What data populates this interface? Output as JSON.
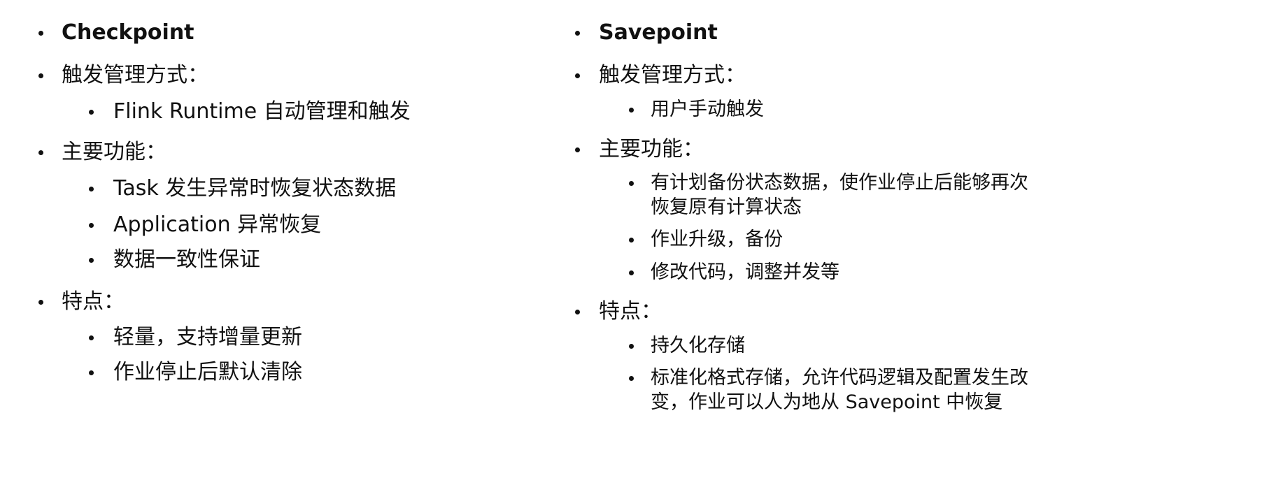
{
  "left": {
    "title": "Checkpoint",
    "trigger_label": "触发管理方式：",
    "trigger_items": [
      "Flink Runtime 自动管理和触发"
    ],
    "function_label": "主要功能：",
    "function_items": [
      "Task 发生异常时恢复状态数据",
      "Application 异常恢复",
      "数据一致性保证"
    ],
    "feature_label": "特点：",
    "feature_items": [
      "轻量，支持增量更新",
      "作业停止后默认清除"
    ]
  },
  "right": {
    "title": "Savepoint",
    "trigger_label": "触发管理方式：",
    "trigger_items": [
      "用户手动触发"
    ],
    "function_label": "主要功能：",
    "function_items": [
      {
        "lines": [
          "有计划备份状态数据，使作业停止后能够再次",
          "恢复原有计算状态"
        ]
      },
      {
        "lines": [
          "作业升级，备份"
        ]
      },
      {
        "lines": [
          "修改代码，调整并发等"
        ]
      }
    ],
    "feature_label": "特点：",
    "feature_items": [
      {
        "lines": [
          "持久化存储"
        ]
      },
      {
        "lines": [
          "标准化格式存储，允许代码逻辑及配置发生改",
          "变，作业可以人为地从 Savepoint 中恢复"
        ]
      }
    ]
  }
}
